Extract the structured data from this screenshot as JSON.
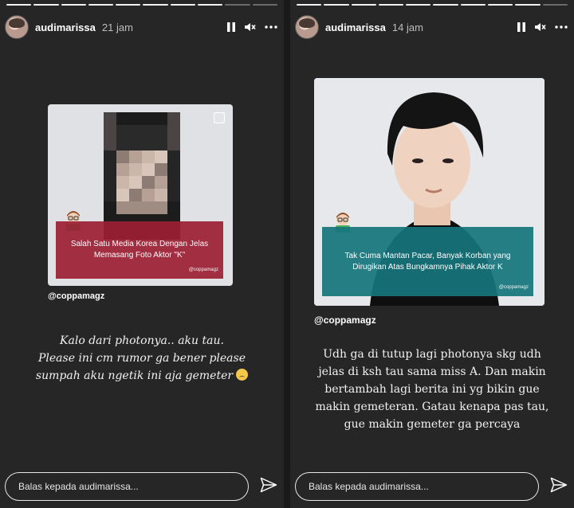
{
  "stories": [
    {
      "username": "audimarissa",
      "time": "21 jam",
      "progress_done": 8,
      "progress_total": 10,
      "card": {
        "caption": "Salah Satu Media Korea Dengan Jelas Memasang Foto Aktor \"K\"",
        "source": "@coppamagz"
      },
      "handle": "@coppamagz",
      "text_lines": [
        "Kalo dari photonya.. aku tau.",
        "Please ini cm rumor ga bener please",
        "sumpah aku ngetik ini aja gemeter"
      ],
      "reply_placeholder": "Balas kepada audimarissa..."
    },
    {
      "username": "audimarissa",
      "time": "14 jam",
      "progress_done": 9,
      "progress_total": 10,
      "card": {
        "caption": "Tak Cuma Mantan Pacar, Banyak Korban yang Dirugikan Atas Bungkamnya Pihak Aktor K",
        "source": "@coppamagz"
      },
      "handle": "@coppamagz",
      "text_lines": [
        "Udh ga di tutup lagi photonya skg udh",
        "jelas di ksh tau sama miss A. Dan makin",
        "bertambah lagi berita ini yg bikin gue",
        "makin gemeteran. Gatau kenapa pas tau,",
        "gue makin gemeter ga percaya"
      ],
      "reply_placeholder": "Balas kepada audimarissa..."
    }
  ],
  "icons": {
    "pause": "pause-icon",
    "mute": "mute-icon",
    "more": "more-icon",
    "send": "send-icon"
  },
  "colors": {
    "background": "#262626",
    "caption_red": "#9c1e34",
    "caption_teal": "#16747c"
  }
}
